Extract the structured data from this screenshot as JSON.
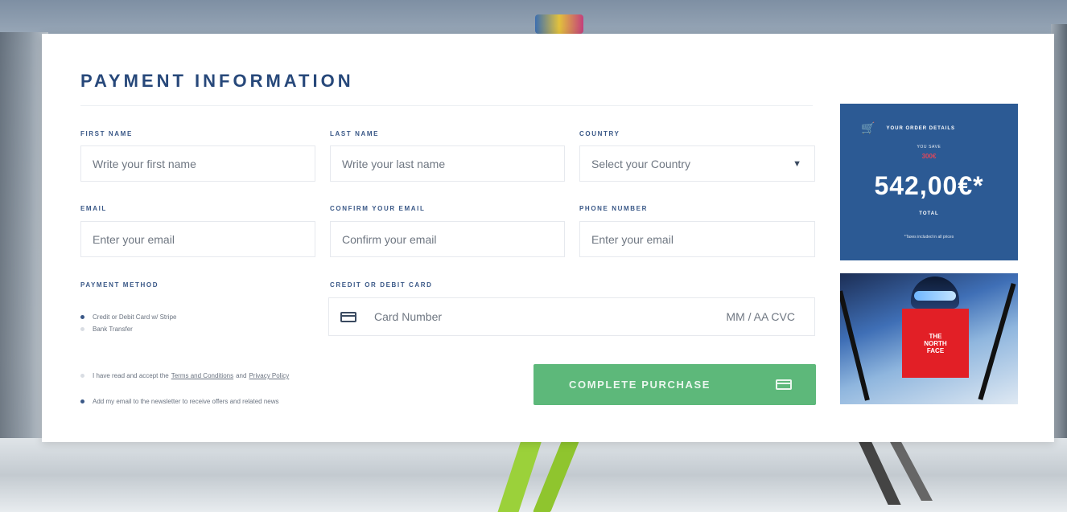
{
  "form": {
    "title": "PAYMENT INFORMATION",
    "first_name": {
      "label": "FIRST NAME",
      "placeholder": "Write your first name"
    },
    "last_name": {
      "label": "LAST NAME",
      "placeholder": "Write your last name"
    },
    "country": {
      "label": "COUNTRY",
      "selected": "Select your Country"
    },
    "email": {
      "label": "EMAIL",
      "placeholder": "Enter your email"
    },
    "confirm_email": {
      "label": "CONFIRM YOUR EMAIL",
      "placeholder": "Confirm your email"
    },
    "phone": {
      "label": "PHONE NUMBER",
      "placeholder": "Enter your email"
    },
    "payment_method": {
      "label": "PAYMENT METHOD",
      "options": [
        {
          "label": "Credit or Debit Card w/ Stripe",
          "selected": true
        },
        {
          "label": "Bank Transfer",
          "selected": false
        }
      ]
    },
    "card": {
      "label": "CREDIT OR DEBIT CARD",
      "number_placeholder": "Card Number",
      "exp_cvc": "MM / AA  CVC"
    },
    "terms": {
      "prefix": "I have read and accept the",
      "terms_link": "Terms and Conditions",
      "middle": "and",
      "privacy_link": "Privacy Policy",
      "checked": false
    },
    "newsletter": {
      "label": "Add my email to the newsletter to receive offers and related news",
      "checked": true
    },
    "submit_label": "COMPLETE PURCHASE"
  },
  "order_summary": {
    "heading": "YOUR ORDER DETAILS",
    "save_label": "YOU SAVE",
    "save_amount": "300€",
    "total": "542,00€*",
    "total_label": "TOTAL",
    "tax_note": "*Taxes included in all prices"
  },
  "promo": {
    "brand_logo_text": "THE\nNORTH\nFACE"
  },
  "colors": {
    "title": "#27487a",
    "summary_bg": "#2c5a94",
    "button": "#5db87a",
    "logo_red": "#e21f26"
  },
  "icons": [
    "cart-icon",
    "credit-card-icon",
    "chevron-down-icon"
  ]
}
